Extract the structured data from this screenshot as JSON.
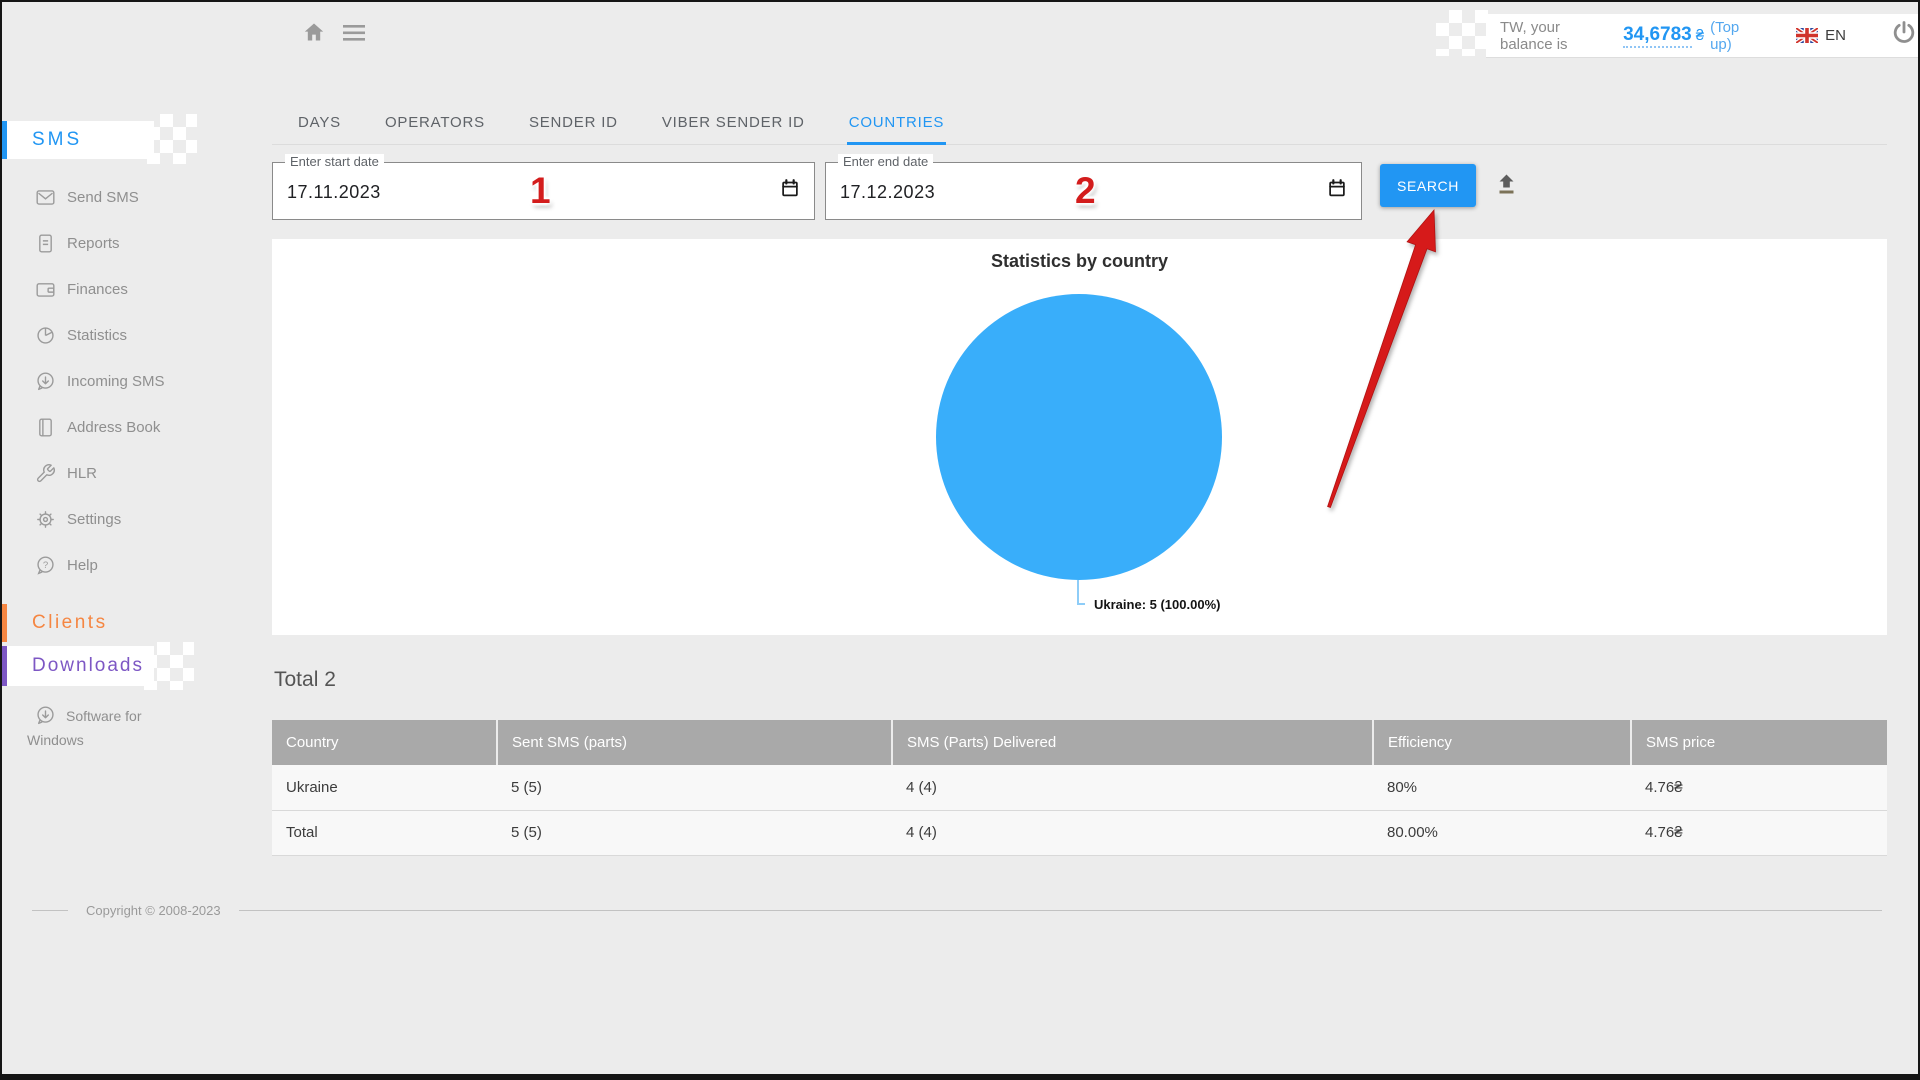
{
  "colors": {
    "accent_blue": "#2196f3",
    "pie_blue": "#39aefa",
    "clients_orange": "#f58642",
    "downloads_purple": "#7d57c4",
    "annotation_red": "#d31c1c",
    "table_header_bg": "#a9a9a9"
  },
  "topbar": {
    "home_icon": "home-icon",
    "menu_icon": "hamburger-menu-icon",
    "balance_prefix": "TW, your balance is",
    "balance_value": "34,6783",
    "balance_currency": "₴",
    "topup_label": "(Top up)",
    "language": "EN",
    "power_icon": "power-icon"
  },
  "sidebar": {
    "section_sms": "SMS",
    "items": [
      {
        "label": "Send SMS",
        "icon": "envelope-icon"
      },
      {
        "label": "Reports",
        "icon": "document-icon"
      },
      {
        "label": "Finances",
        "icon": "wallet-icon"
      },
      {
        "label": "Statistics",
        "icon": "pie-chart-icon"
      },
      {
        "label": "Incoming SMS",
        "icon": "bubble-download-icon"
      },
      {
        "label": "Address Book",
        "icon": "book-icon"
      },
      {
        "label": "HLR",
        "icon": "wrench-icon"
      },
      {
        "label": "Settings",
        "icon": "gear-icon"
      },
      {
        "label": "Help",
        "icon": "question-bubble-icon"
      }
    ],
    "section_clients": "Clients",
    "section_downloads": "Downloads",
    "software_item": {
      "label": "Software for Windows",
      "icon": "bubble-download-icon"
    }
  },
  "tabs": [
    {
      "label": "DAYS"
    },
    {
      "label": "OPERATORS"
    },
    {
      "label": "SENDER ID"
    },
    {
      "label": "VIBER SENDER ID"
    },
    {
      "label": "COUNTRIES",
      "active": true
    }
  ],
  "filters": {
    "start_date": {
      "label": "Enter start date",
      "value": "17.11.2023"
    },
    "end_date": {
      "label": "Enter end date",
      "value": "17.12.2023"
    },
    "search_label": "SEARCH",
    "upload_icon": "export-upload-icon",
    "annotation_1": "1",
    "annotation_2": "2"
  },
  "chart_data": {
    "type": "pie",
    "title": "Statistics by country",
    "slices": [
      {
        "label": "Ukraine",
        "value": 5,
        "percent": "100.00%"
      }
    ],
    "callout": "Ukraine: 5 (100.00%)",
    "color": "#39aefa",
    "legend_position": "none"
  },
  "summary": {
    "total_label": "Total 2"
  },
  "table": {
    "headers": [
      "Country",
      "Sent SMS (parts)",
      "SMS (Parts) Delivered",
      "Efficiency",
      "SMS price"
    ],
    "rows": [
      [
        "Ukraine",
        "5 (5)",
        "4 (4)",
        "80%",
        "4.76₴"
      ],
      [
        "Total",
        "5 (5)",
        "4 (4)",
        "80.00%",
        "4.76₴"
      ]
    ]
  },
  "footer": {
    "copyright": "Copyright © 2008-2023"
  }
}
